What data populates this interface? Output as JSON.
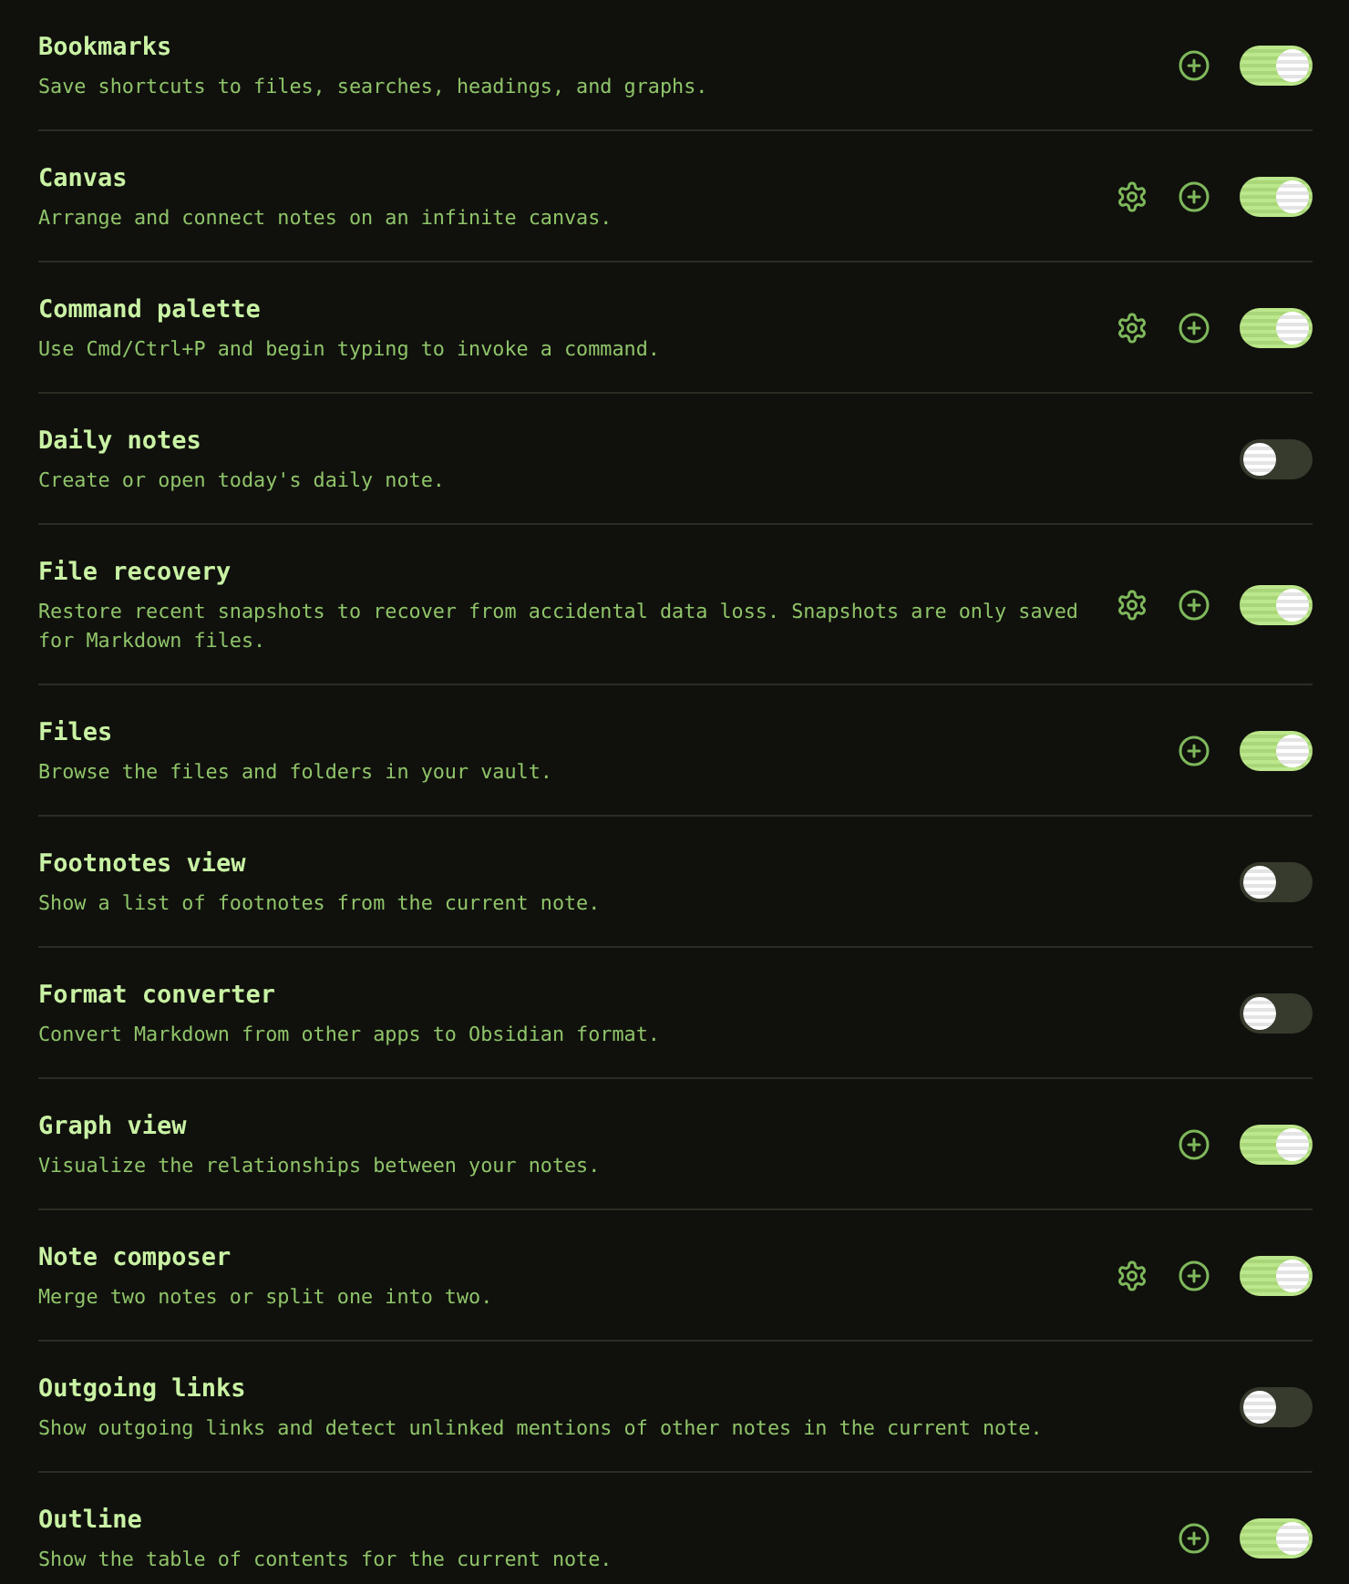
{
  "plugins": [
    {
      "name": "Bookmarks",
      "description": "Save shortcuts to files, searches, headings, and graphs.",
      "has_settings": false,
      "has_hotkeys": true,
      "enabled": true
    },
    {
      "name": "Canvas",
      "description": "Arrange and connect notes on an infinite canvas.",
      "has_settings": true,
      "has_hotkeys": true,
      "enabled": true
    },
    {
      "name": "Command palette",
      "description": "Use Cmd/Ctrl+P and begin typing to invoke a command.",
      "has_settings": true,
      "has_hotkeys": true,
      "enabled": true
    },
    {
      "name": "Daily notes",
      "description": "Create or open today's daily note.",
      "has_settings": false,
      "has_hotkeys": false,
      "enabled": false
    },
    {
      "name": "File recovery",
      "description": "Restore recent snapshots to recover from accidental data loss. Snapshots are only saved for Markdown files.",
      "has_settings": true,
      "has_hotkeys": true,
      "enabled": true
    },
    {
      "name": "Files",
      "description": "Browse the files and folders in your vault.",
      "has_settings": false,
      "has_hotkeys": true,
      "enabled": true
    },
    {
      "name": "Footnotes view",
      "description": "Show a list of footnotes from the current note.",
      "has_settings": false,
      "has_hotkeys": false,
      "enabled": false
    },
    {
      "name": "Format converter",
      "description": "Convert Markdown from other apps to Obsidian format.",
      "has_settings": false,
      "has_hotkeys": false,
      "enabled": false
    },
    {
      "name": "Graph view",
      "description": "Visualize the relationships between your notes.",
      "has_settings": false,
      "has_hotkeys": true,
      "enabled": true
    },
    {
      "name": "Note composer",
      "description": "Merge two notes or split one into two.",
      "has_settings": true,
      "has_hotkeys": true,
      "enabled": true
    },
    {
      "name": "Outgoing links",
      "description": "Show outgoing links and detect unlinked mentions of other notes in the current note.",
      "has_settings": false,
      "has_hotkeys": false,
      "enabled": false
    },
    {
      "name": "Outline",
      "description": "Show the table of contents for the current note.",
      "has_settings": false,
      "has_hotkeys": true,
      "enabled": true
    }
  ]
}
